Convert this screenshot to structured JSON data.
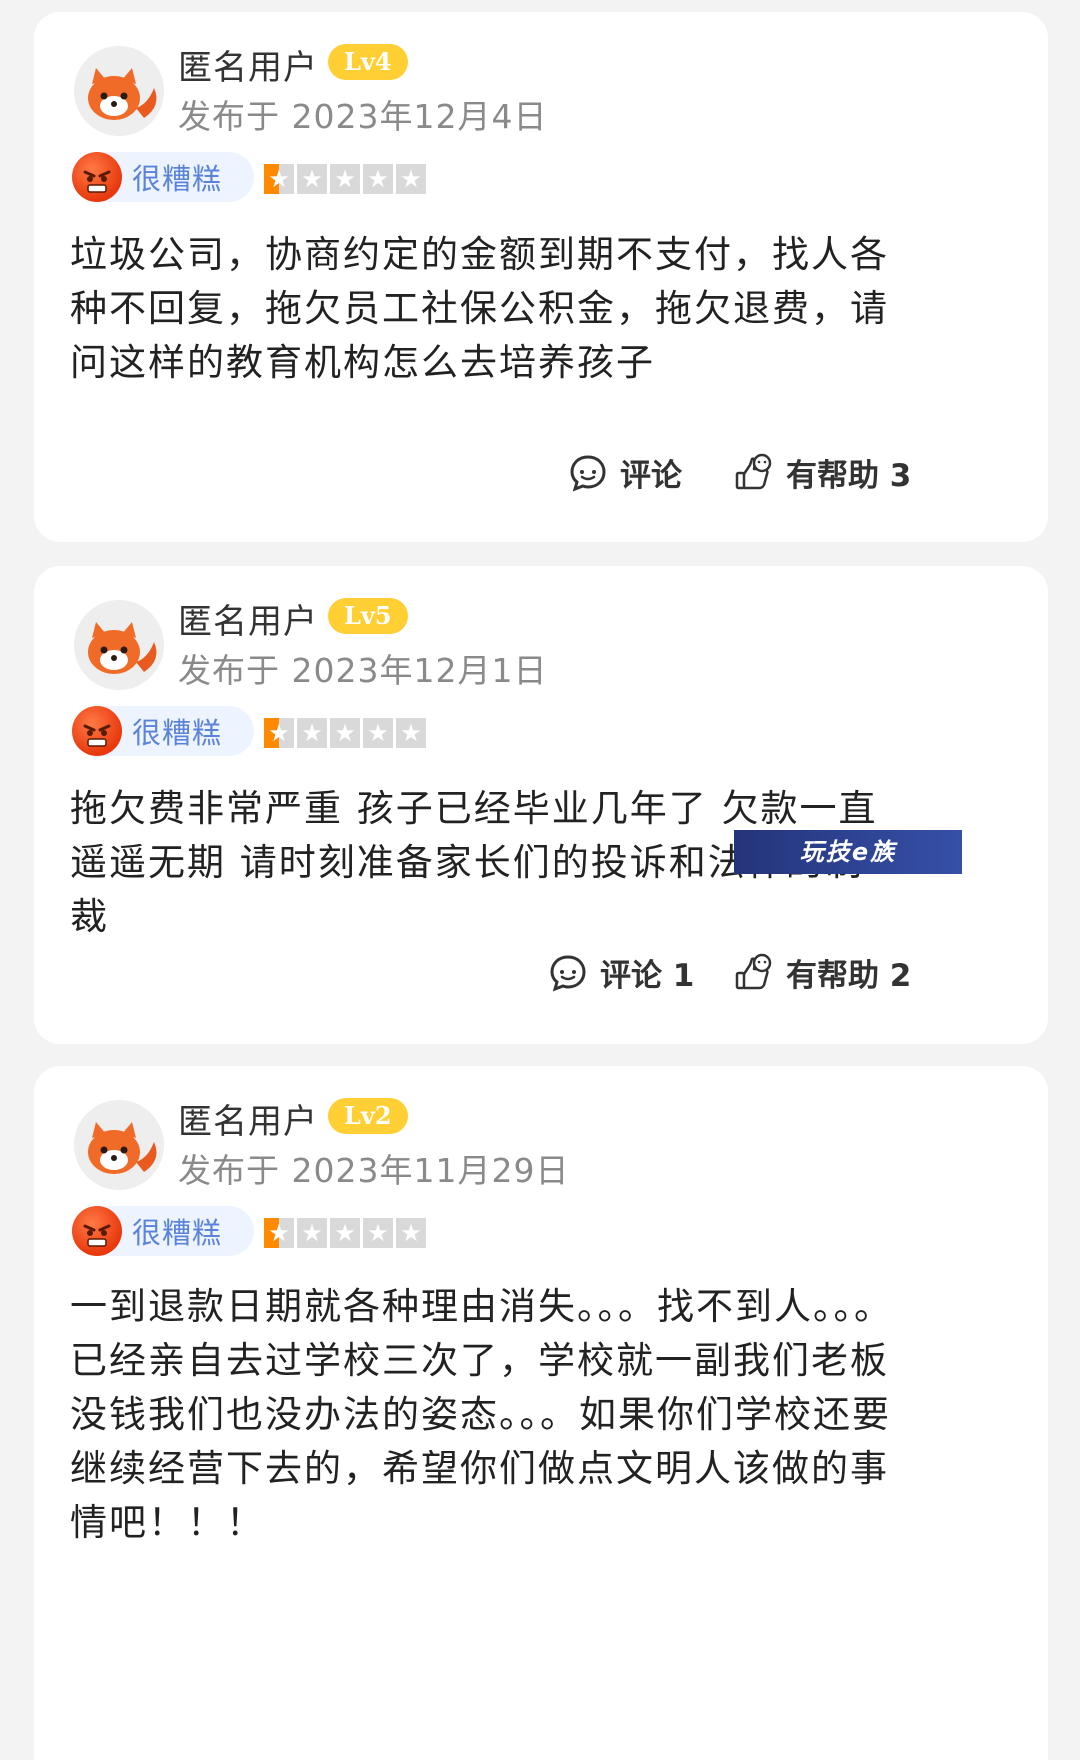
{
  "reviews": [
    {
      "username": "匿名用户",
      "level": "Lv4",
      "date": "发布于 2023年12月4日",
      "rating_label": "很糟糕",
      "stars": 1,
      "text": "垃圾公司，协商约定的金额到期不支付，找人各种不回复，拖欠员工社保公积金，拖欠退费，请问这样的教育机构怎么去培养孩子",
      "comment_label": "评论",
      "helpful_label": "有帮助 3"
    },
    {
      "username": "匿名用户",
      "level": "Lv5",
      "date": "发布于 2023年12月1日",
      "rating_label": "很糟糕",
      "stars": 1,
      "text": "拖欠费非常严重 孩子已经毕业几年了 欠款一直遥遥无期 请时刻准备家长们的投诉和法律的制裁",
      "comment_label": "评论 1",
      "helpful_label": "有帮助 2"
    },
    {
      "username": "匿名用户",
      "level": "Lv2",
      "date": "发布于 2023年11月29日",
      "rating_label": "很糟糕",
      "stars": 1,
      "text": "一到退款日期就各种理由消失。。。找不到人。。。已经亲自去过学校三次了，学校就一副我们老板没钱我们也没办法的姿态。。。如果你们学校还要继续经营下去的，希望你们做点文明人该做的事情吧！！！"
    }
  ],
  "watermark": "玩技e族",
  "colors": {
    "level_badge": "#ffcf33",
    "rating_label": "#5b84d8",
    "star_active": "#ff8a00",
    "star_inactive": "#d9d9d9",
    "date_text": "#8a8a8a"
  }
}
